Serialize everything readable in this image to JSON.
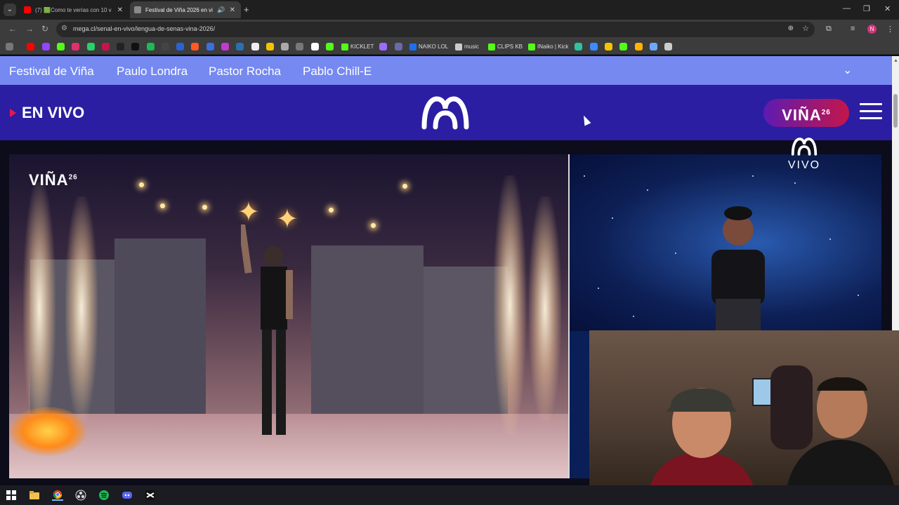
{
  "browser": {
    "tabs": [
      {
        "title": "(7) 🟩Como te verías con 10 v",
        "favicon_color": "#ff0000"
      },
      {
        "title": "Festival de Viña 2026 en vi",
        "favicon_color": "#8a8a8a",
        "active": true
      }
    ],
    "new_tab": "+",
    "url": "mega.cl/senal-en-vivo/lengua-de-senas-vina-2026/",
    "profile_initial": "N",
    "bookmarks": [
      {
        "label": "KICKLET",
        "color": "#53fc18"
      },
      {
        "label": "NAIKO LOL",
        "color": "#1e6ff0"
      },
      {
        "label": "music",
        "color": "#cccccc"
      },
      {
        "label": "CLIPS KB",
        "color": "#53fc18"
      },
      {
        "label": "INaiko | Kick",
        "color": "#53fc18"
      }
    ]
  },
  "site": {
    "topnav": [
      "Festival de Viña",
      "Paulo Londra",
      "Pastor Rocha",
      "Pablo Chill-E"
    ],
    "live_label": "EN VIVO",
    "brand_badge": "VIÑA",
    "brand_badge_year": "26",
    "watermark": "VIÑA",
    "watermark_year": "26",
    "corner_label": "VIVO",
    "colors": {
      "topnav": "#7589f1",
      "header": "#2b1ea3",
      "live_marker": "#e8164f"
    }
  },
  "taskbar": {
    "icons": [
      "windows-icon",
      "file-explorer-icon",
      "chrome-icon",
      "obs-icon",
      "spotify-icon",
      "discord-icon",
      "capcut-icon"
    ]
  }
}
